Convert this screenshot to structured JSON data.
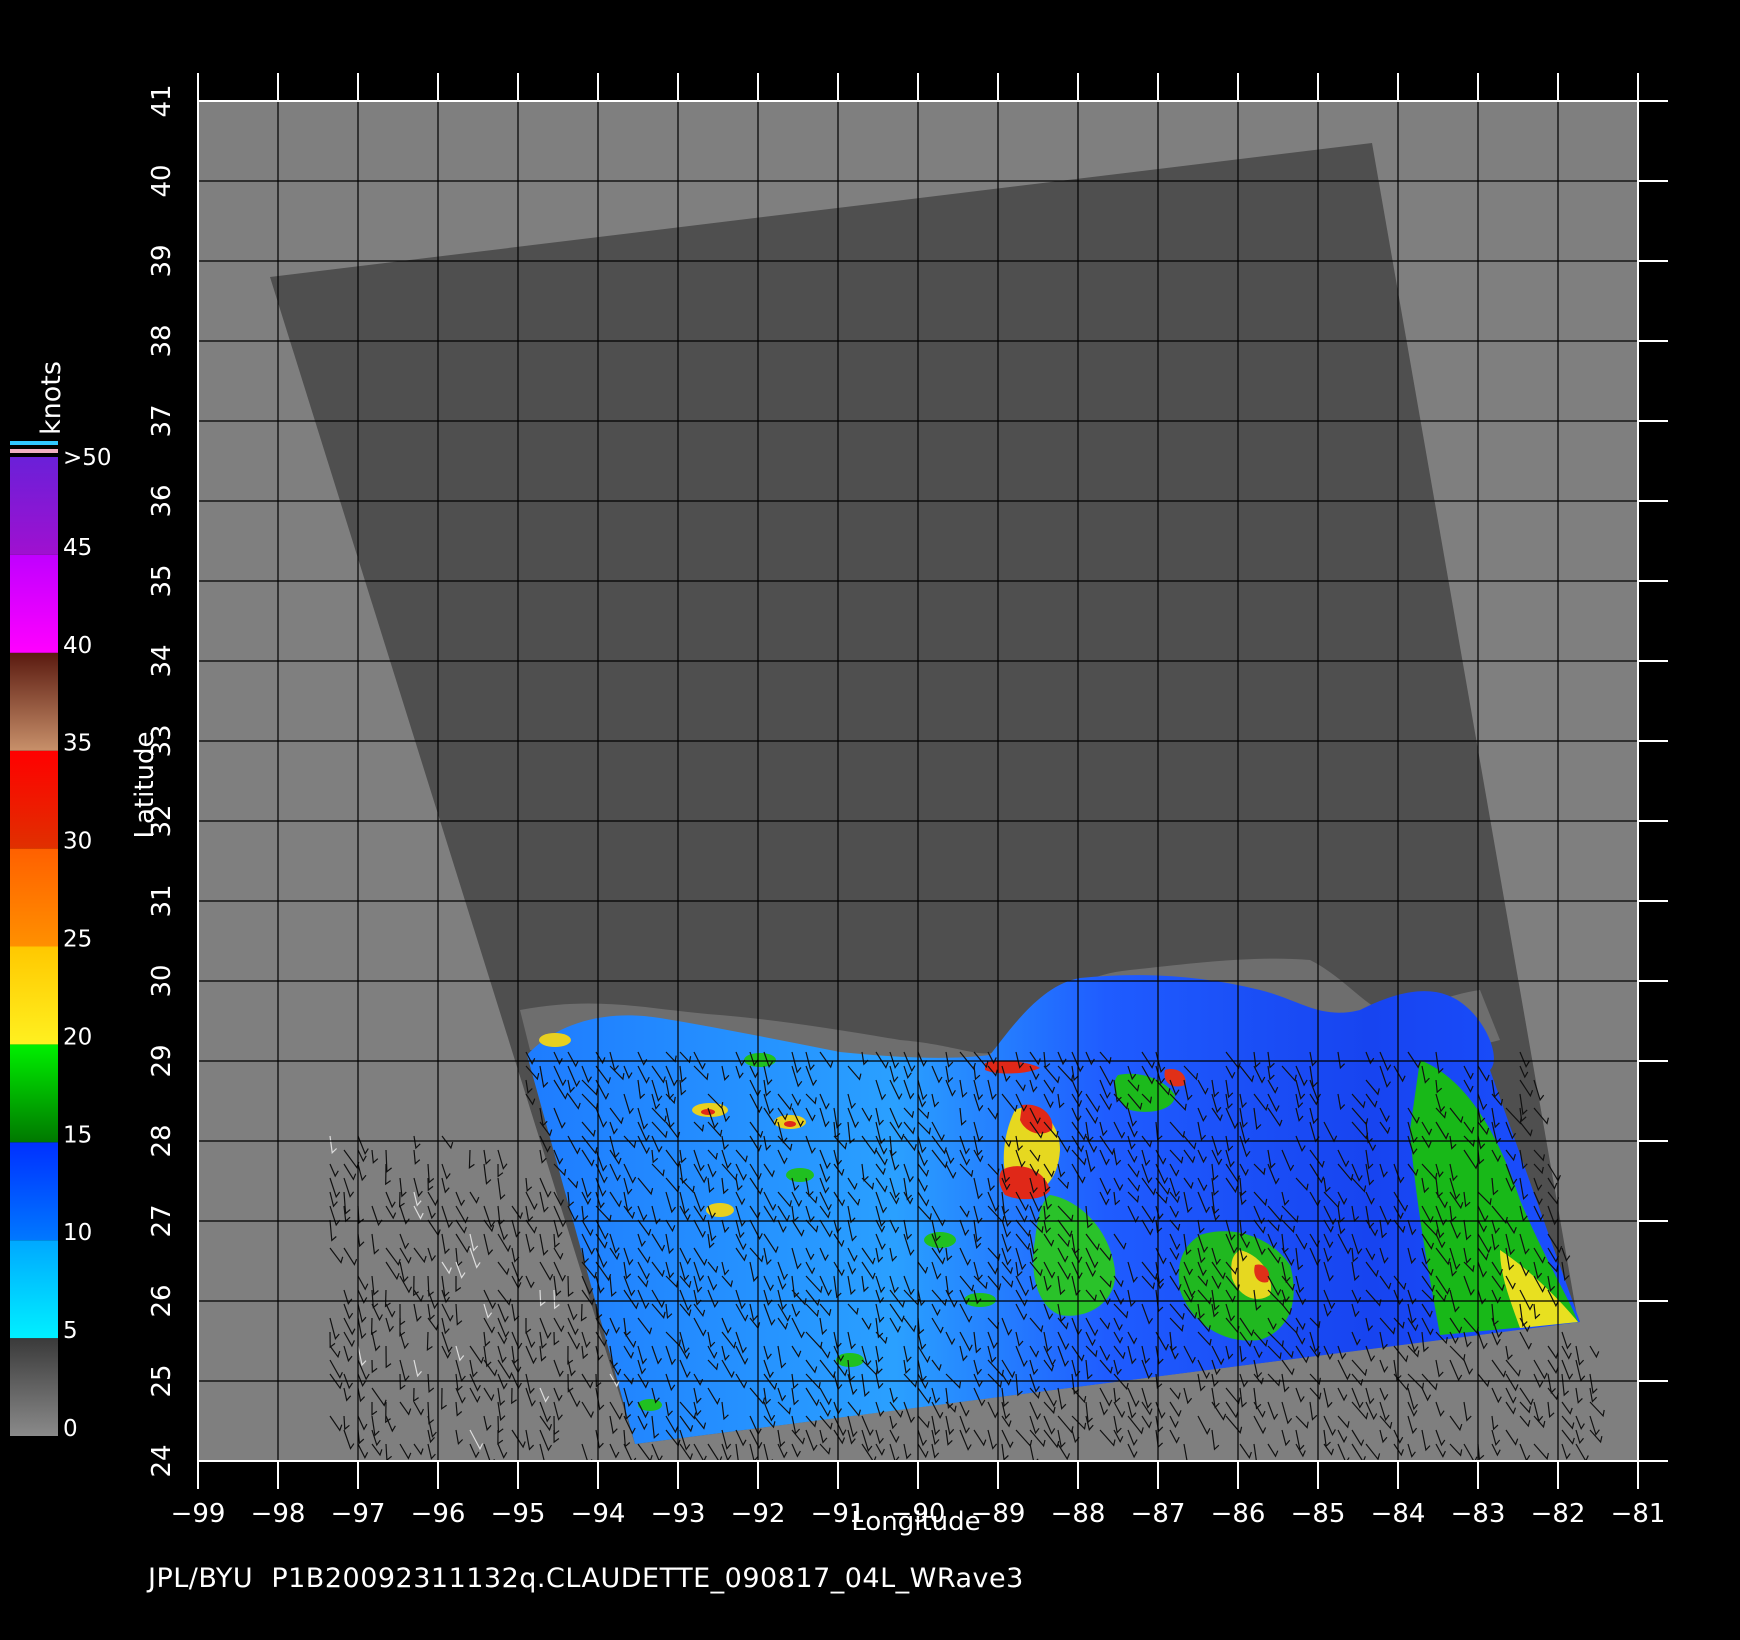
{
  "map": {
    "x_axis_label": "Longitude",
    "y_axis_label": "Latitude",
    "lon_ticks": [
      "−99",
      "−98",
      "−97",
      "−96",
      "−95",
      "−94",
      "−93",
      "−92",
      "−91",
      "−90",
      "−89",
      "−88",
      "−87",
      "−86",
      "−85",
      "−84",
      "−83",
      "−82",
      "−81"
    ],
    "lat_ticks": [
      "24",
      "25",
      "26",
      "27",
      "28",
      "29",
      "30",
      "31",
      "32",
      "33",
      "34",
      "35",
      "36",
      "37",
      "38",
      "39",
      "40",
      "41"
    ],
    "lon_range": [
      -99,
      -81
    ],
    "lat_range": [
      24,
      41
    ],
    "grid": true,
    "colors": {
      "land": "#7f7f7f",
      "swath_no_data": "#4f4f4f",
      "ocean_low": "#1a5cff",
      "ocean_mid": "#2fa8ff",
      "ocean_high": "#00c800"
    }
  },
  "colorbar": {
    "unit": "knots",
    "labels": [
      ">50",
      "45",
      "40",
      "35",
      "30",
      "25",
      "20",
      "15",
      "10",
      "5",
      "0"
    ],
    "segments": [
      {
        "from": 0,
        "to": 5,
        "top": "#3a3a3a",
        "bottom": "#8a8a8a"
      },
      {
        "from": 5,
        "to": 10,
        "top": "#00a8ff",
        "bottom": "#00f0ff"
      },
      {
        "from": 10,
        "to": 15,
        "top": "#0030ff",
        "bottom": "#0078ff"
      },
      {
        "from": 15,
        "to": 20,
        "top": "#00f000",
        "bottom": "#007800"
      },
      {
        "from": 20,
        "to": 25,
        "top": "#ffc800",
        "bottom": "#fff020"
      },
      {
        "from": 25,
        "to": 30,
        "top": "#ff6000",
        "bottom": "#ff9000"
      },
      {
        "from": 30,
        "to": 35,
        "top": "#ff0000",
        "bottom": "#e03000"
      },
      {
        "from": 35,
        "to": 40,
        "top": "#5a1a10",
        "bottom": "#c8906a"
      },
      {
        "from": 40,
        "to": 45,
        "top": "#c000ff",
        "bottom": "#ff00ff"
      },
      {
        "from": 45,
        "to": 50,
        "top": "#6a20d8",
        "bottom": "#a010d0"
      }
    ]
  },
  "footer": {
    "text": "JPL/BYU  P1B20092311132q.CLAUDETTE_090817_04L_WRave3"
  }
}
